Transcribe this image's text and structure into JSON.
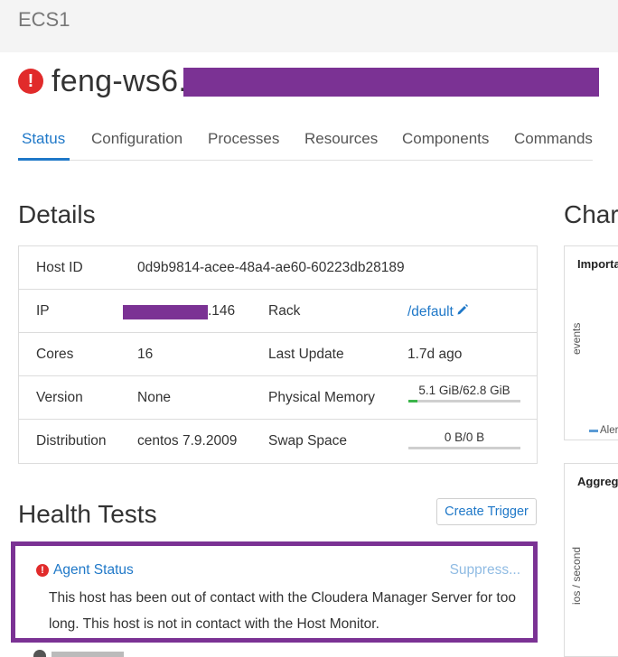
{
  "app": {
    "title": "ECS1"
  },
  "host": {
    "name": "feng-ws6.s",
    "status_icon": "error-icon",
    "status_color": "#e12b2b"
  },
  "tabs": [
    {
      "label": "Status",
      "active": true
    },
    {
      "label": "Configuration",
      "active": false
    },
    {
      "label": "Processes",
      "active": false
    },
    {
      "label": "Resources",
      "active": false
    },
    {
      "label": "Components",
      "active": false
    },
    {
      "label": "Commands",
      "active": false
    }
  ],
  "details": {
    "title": "Details",
    "host_id_label": "Host ID",
    "host_id": "0d9b9814-acee-48a4-ae60-60223db28189",
    "ip_label": "IP",
    "ip_suffix": ".146",
    "rack_label": "Rack",
    "rack_value": "/default",
    "cores_label": "Cores",
    "cores_value": "16",
    "last_update_label": "Last Update",
    "last_update_value": "1.7d ago",
    "version_label": "Version",
    "version_value": "None",
    "physical_memory_label": "Physical Memory",
    "physical_memory_value": "5.1 GiB/62.8 GiB",
    "physical_memory_fraction": 0.081,
    "distribution_label": "Distribution",
    "distribution_value": "centos 7.9.2009",
    "swap_label": "Swap Space",
    "swap_value": "0 B/0 B",
    "swap_fraction": 0
  },
  "health": {
    "title": "Health Tests",
    "create_trigger_label": "Create Trigger",
    "alert": {
      "name": "Agent Status",
      "suppress_label": "Suppress...",
      "message": "This host has been out of contact with the Cloudera Manager Server for too long. This host is not in contact with the Host Monitor."
    }
  },
  "charts": {
    "title": "Char",
    "card1_title": "Importa",
    "card1_ylabel": "events",
    "card1_legend": "Aler",
    "card2_title": "Aggreg",
    "card2_ylabel": "ios / second"
  },
  "colors": {
    "accent": "#1f78c8",
    "error": "#e12b2b",
    "highlight": "#7b3294",
    "memory_bar": "#3bb44a"
  }
}
